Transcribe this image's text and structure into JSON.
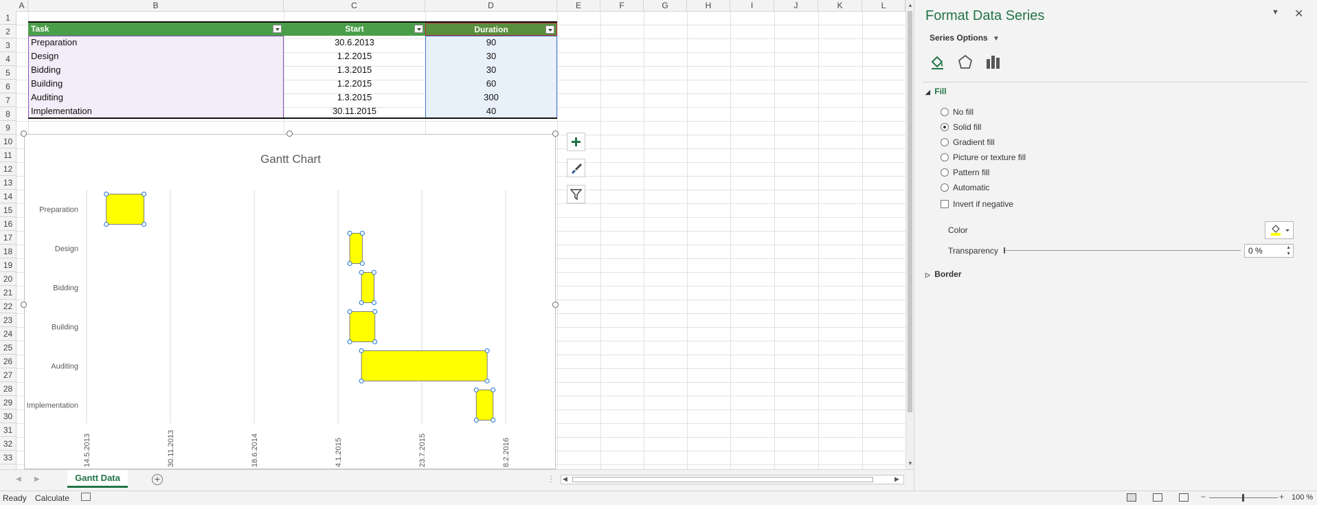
{
  "columns": [
    "A",
    "B",
    "C",
    "D",
    "E",
    "F",
    "G",
    "H",
    "I",
    "J",
    "K",
    "L"
  ],
  "rows": [
    "1",
    "2",
    "3",
    "4",
    "5",
    "6",
    "7",
    "8",
    "9",
    "10",
    "11",
    "12",
    "13",
    "14",
    "15",
    "16",
    "17",
    "18",
    "19",
    "20",
    "21",
    "22",
    "23",
    "24",
    "25",
    "26",
    "27",
    "28",
    "29",
    "30",
    "31",
    "32",
    "33"
  ],
  "table": {
    "headers": [
      "Task",
      "Start",
      "Duration"
    ],
    "rows": [
      {
        "task": "Preparation",
        "start": "30.6.2013",
        "duration": "90"
      },
      {
        "task": "Design",
        "start": "1.2.2015",
        "duration": "30"
      },
      {
        "task": "Bidding",
        "start": "1.3.2015",
        "duration": "30"
      },
      {
        "task": "Building",
        "start": "1.2.2015",
        "duration": "60"
      },
      {
        "task": "Auditing",
        "start": "1.3.2015",
        "duration": "300"
      },
      {
        "task": "Implementation",
        "start": "30.11.2015",
        "duration": "40"
      }
    ]
  },
  "chart_data": {
    "type": "bar",
    "orientation": "horizontal",
    "stacked": true,
    "title": "Gantt Chart",
    "categories": [
      "Preparation",
      "Design",
      "Bidding",
      "Building",
      "Auditing",
      "Implementation"
    ],
    "series": [
      {
        "values": [
          "2013-06-30",
          "2015-02-01",
          "2015-03-01",
          "2015-02-01",
          "2015-03-01",
          "2015-11-30"
        ],
        "color": "none"
      },
      {
        "values": [
          90,
          30,
          30,
          60,
          300,
          40
        ],
        "color": "#ffff00"
      }
    ],
    "x_ticks": [
      "14.5.2013",
      "30.11.2013",
      "18.6.2014",
      "4.1.2015",
      "23.7.2015",
      "8.2.2016"
    ],
    "xlim": [
      "2013-05-14",
      "2016-02-08"
    ],
    "grid": true
  },
  "pane": {
    "title": "Format Data Series",
    "series_options": "Series Options",
    "fill_section": "Fill",
    "options": [
      {
        "label": "No fill",
        "checked": false
      },
      {
        "label": "Solid fill",
        "checked": true
      },
      {
        "label": "Gradient fill",
        "checked": false
      },
      {
        "label": "Picture or texture fill",
        "checked": false
      },
      {
        "label": "Pattern fill",
        "checked": false
      },
      {
        "label": "Automatic",
        "checked": false
      }
    ],
    "invert_label": "Invert if negative",
    "color_label": "Color",
    "transparency_label": "Transparency",
    "transparency_value": "0 %",
    "border_section": "Border",
    "accent_color": "#217346",
    "fill_color": "#ffff00"
  },
  "sheet_tab": "Gantt Data",
  "status": {
    "ready": "Ready",
    "calculate": "Calculate",
    "zoom": "100 %"
  }
}
